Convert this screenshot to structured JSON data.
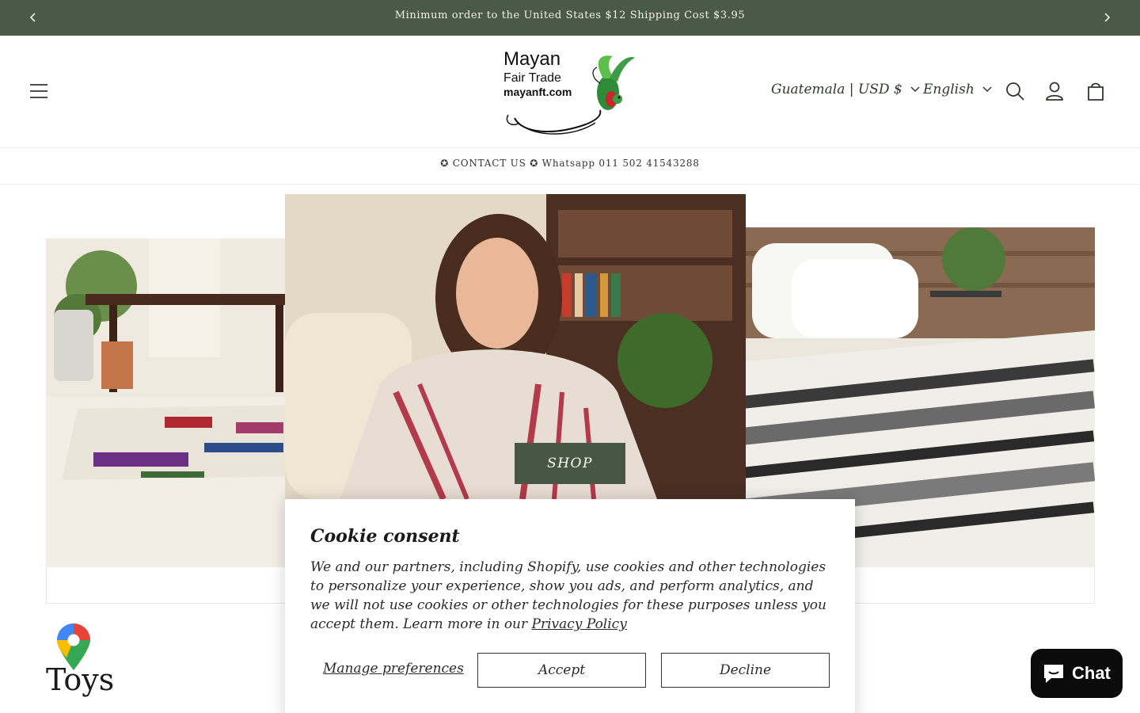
{
  "announcement": {
    "message": "Minimum order to the United States $12 Shipping Cost $3.95"
  },
  "header": {
    "logo": {
      "line1": "Mayan",
      "line2": "Fair Trade",
      "line3": "mayanft.com"
    },
    "country_selector": "Guatemala | USD $",
    "language_selector": "English"
  },
  "subbar": {
    "message": "✪ CONTACT US ✪ Whatsapp 011 502 41543288"
  },
  "hero": {
    "shop_label": "SHOP"
  },
  "section": {
    "title": "Toys"
  },
  "cookie": {
    "title": "Cookie consent",
    "body": "We and our partners, including Shopify, use cookies and other technologies to personalize your experience, show you ads, and perform analytics, and we will not use cookies or other technologies for these purposes unless you accept them. Learn more in our",
    "privacy_link": "Privacy Policy",
    "manage_label": "Manage preferences",
    "accept_label": "Accept",
    "decline_label": "Decline"
  },
  "chat": {
    "label": "Chat"
  },
  "colors": {
    "brand_green": "#4a5a47",
    "button_green": "#485744",
    "chat_black": "#0b0b0b"
  }
}
